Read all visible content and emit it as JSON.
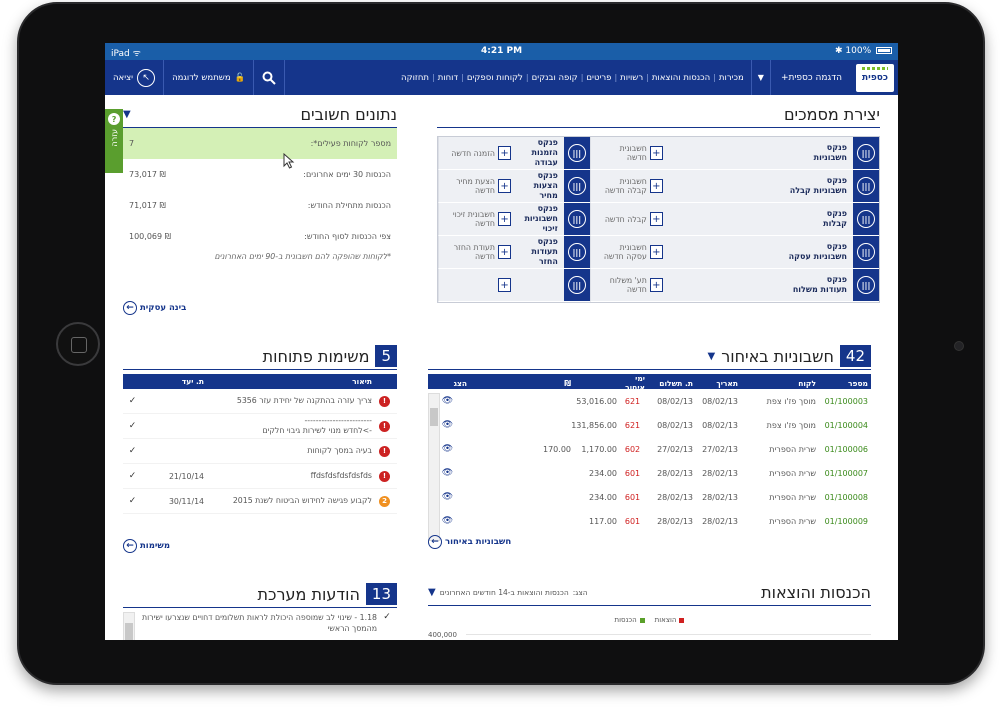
{
  "status": {
    "device": "iPad",
    "time": "4:21 PM",
    "battery": "100%"
  },
  "nav": {
    "logo": "כספית",
    "new_invoice": "הדגמה כספית+",
    "menu": [
      "מכירות",
      "הכנסות והוצאות",
      "רשויות",
      "פריטים",
      "קופה ובנקים",
      "לקוחות וספקים",
      "דוחות",
      "תחזוקה"
    ],
    "demo_user": "משתמש לדוגמה",
    "logout": "יציאה"
  },
  "docs": {
    "title": "יצירת מסמכים",
    "rows": [
      [
        {
          "book": "פנקס\nחשבוניות",
          "new": "חשבונית\nחדשה"
        },
        {
          "book": "פנקס\nהזמנות עבודה",
          "new": "הזמנה חדשה"
        }
      ],
      [
        {
          "book": "פנקס\nחשבוניות קבלה",
          "new": "חשבונית\nקבלה חדשה"
        },
        {
          "book": "פנקס\nהצעות מחיר",
          "new": "הצעת מחיר\nחדשה"
        }
      ],
      [
        {
          "book": "פנקס\nקבלות",
          "new": "קבלה חדשה"
        },
        {
          "book": "פנקס\nחשבוניות זיכוי",
          "new": "חשבונית זיכוי\nחדשה"
        }
      ],
      [
        {
          "book": "פנקס\nחשבוניות עסקה",
          "new": "חשבונית\nעסקה חדשה"
        },
        {
          "book": "פנקס\nתעודות החזר",
          "new": "תעודת החזר\nחדשה"
        }
      ],
      [
        {
          "book": "פנקס\nתעודות משלוח",
          "new": "תע' משלוח\nחדשה"
        },
        {
          "book": "",
          "new": ""
        }
      ]
    ]
  },
  "data_panel": {
    "title": "נתונים חשובים",
    "rows": [
      {
        "label": "מספר לקוחות פעילים*:",
        "value": "7"
      },
      {
        "label": "הכנסות 30 ימים אחרונים:",
        "value": "₪ 73,017"
      },
      {
        "label": "הכנסות מתחילת החודש:",
        "value": "₪ 71,017"
      },
      {
        "label": "צפי הכנסות לסוף החודש:",
        "value": "₪ 100,069"
      }
    ],
    "note": "*לקוחות שהופקה להם חשבונית ב-90 ימים האחרונים",
    "help": "עזרה",
    "link": "בינה עסקית"
  },
  "invoices": {
    "count": "42",
    "title": "חשבוניות באיחור",
    "headers": [
      "מספר",
      "לקוח",
      "תאריך",
      "ת. תשלום",
      "ימי איחור",
      "",
      "₪",
      "",
      "הצג"
    ],
    "rows": [
      {
        "num": "01/100003",
        "client": "מוסך פז'ו צפת",
        "date": "08/02/13",
        "pay": "08/02/13",
        "late": "621",
        "amount": "53,016.00",
        "paid": ""
      },
      {
        "num": "01/100004",
        "client": "מוסך פז'ו צפת",
        "date": "08/02/13",
        "pay": "08/02/13",
        "late": "621",
        "amount": "131,856.00",
        "paid": ""
      },
      {
        "num": "01/100006",
        "client": "שרית הספרית",
        "date": "27/02/13",
        "pay": "27/02/13",
        "late": "602",
        "amount": "1,170.00",
        "paid": "170.00"
      },
      {
        "num": "01/100007",
        "client": "שרית הספרית",
        "date": "28/02/13",
        "pay": "28/02/13",
        "late": "601",
        "amount": "234.00",
        "paid": ""
      },
      {
        "num": "01/100008",
        "client": "שרית הספרית",
        "date": "28/02/13",
        "pay": "28/02/13",
        "late": "601",
        "amount": "234.00",
        "paid": ""
      },
      {
        "num": "01/100009",
        "client": "שרית הספרית",
        "date": "28/02/13",
        "pay": "28/02/13",
        "late": "601",
        "amount": "117.00",
        "paid": ""
      }
    ],
    "link": "חשבוניות באיחור"
  },
  "tasks": {
    "count": "5",
    "title": "משימות פתוחות",
    "headers": [
      "תיאור",
      "ת. יעד"
    ],
    "rows": [
      {
        "pri": "red",
        "desc": "צריך עזרה בהתקנה של יחידת עזר 5356",
        "due": ""
      },
      {
        "pri": "red",
        "desc": "------------------------\n->לחדש מנוי לשירות גיבוי חלקים",
        "due": ""
      },
      {
        "pri": "red",
        "desc": "בעיה במסך לקוחות",
        "due": ""
      },
      {
        "pri": "red",
        "desc": "ffdsfdsfdsfdsfds",
        "due": "21/10/14"
      },
      {
        "pri": "orange",
        "desc": "לקבוע פגישה לחידוש הביטוח לשנת 2015",
        "due": "30/11/14"
      }
    ],
    "link": "משימות"
  },
  "income": {
    "title": "הכנסות והוצאות",
    "select_label": "הצג:",
    "select_value": "הכנסות והוצאות ב-14 חודשים האחרונים",
    "legend": [
      {
        "name": "הוצאות",
        "color": "#d02020"
      },
      {
        "name": "הכנסות",
        "color": "#5aa02a"
      }
    ],
    "ytick": "400,000"
  },
  "messages": {
    "count": "13",
    "title": "הודעות מערכת",
    "items": [
      "1.18 - שינוי לב שמוספה היכולת לראות תשלומים דחויים שנצרעו ישירות מהמסך הראשי"
    ]
  }
}
